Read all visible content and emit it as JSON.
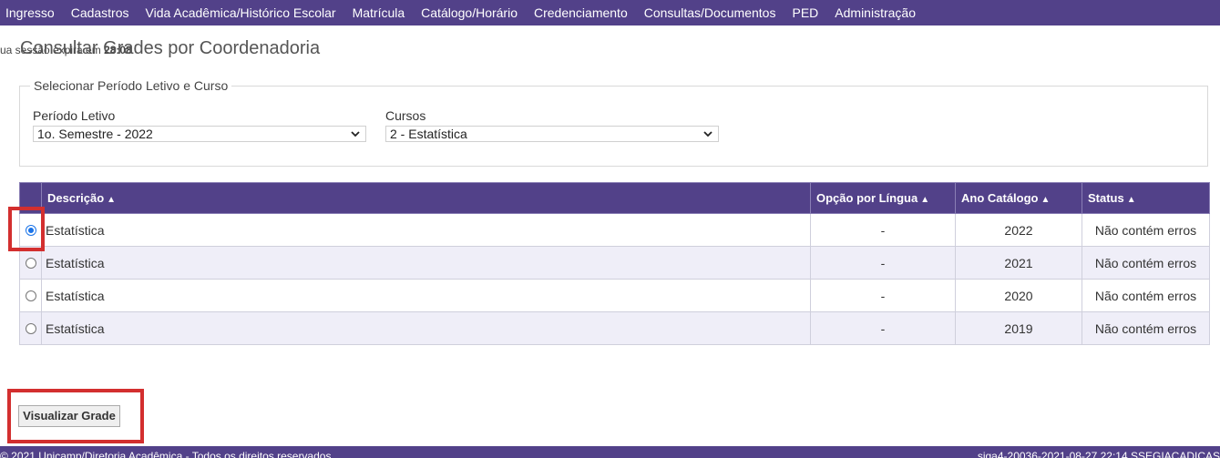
{
  "menu": {
    "items": [
      {
        "label": "Ingresso"
      },
      {
        "label": "Cadastros"
      },
      {
        "label": "Vida Acadêmica/Histórico Escolar"
      },
      {
        "label": "Matrícula"
      },
      {
        "label": "Catálogo/Horário"
      },
      {
        "label": "Credenciamento"
      },
      {
        "label": "Consultas/Documentos"
      },
      {
        "label": "PED"
      },
      {
        "label": "Administração"
      }
    ]
  },
  "session": {
    "prefix": "ua sessão expira em ",
    "time": "28:08"
  },
  "page": {
    "title": "Consultar Grades por Coordenadoria"
  },
  "filters": {
    "legend": "Selecionar Período Letivo e Curso",
    "period": {
      "label": "Período Letivo",
      "value": "1o. Semestre - 2022"
    },
    "course": {
      "label": "Cursos",
      "value": "2 - Estatística"
    }
  },
  "table": {
    "headers": {
      "descricao": "Descrição",
      "opcao": "Opção por Língua",
      "ano": "Ano Catálogo",
      "status": "Status"
    },
    "rows": [
      {
        "descricao": "Estatística",
        "opcao": "-",
        "ano": "2022",
        "status": "Não contém erros",
        "selected": true
      },
      {
        "descricao": "Estatística",
        "opcao": "-",
        "ano": "2021",
        "status": "Não contém erros",
        "selected": false
      },
      {
        "descricao": "Estatística",
        "opcao": "-",
        "ano": "2020",
        "status": "Não contém erros",
        "selected": false
      },
      {
        "descricao": "Estatística",
        "opcao": "-",
        "ano": "2019",
        "status": "Não contém erros",
        "selected": false
      }
    ]
  },
  "actions": {
    "view_label": "Visualizar Grade"
  },
  "footer": {
    "left": "© 2021 Unicamp/Diretoria Acadêmica - Todos os direitos reservados",
    "right": "siga4-20036-2021-08-27 22:14 SSEGIACADICAS"
  },
  "colors": {
    "brand": "#524189",
    "highlight": "#d32f2f",
    "radio_selected": "#1a73e8"
  }
}
